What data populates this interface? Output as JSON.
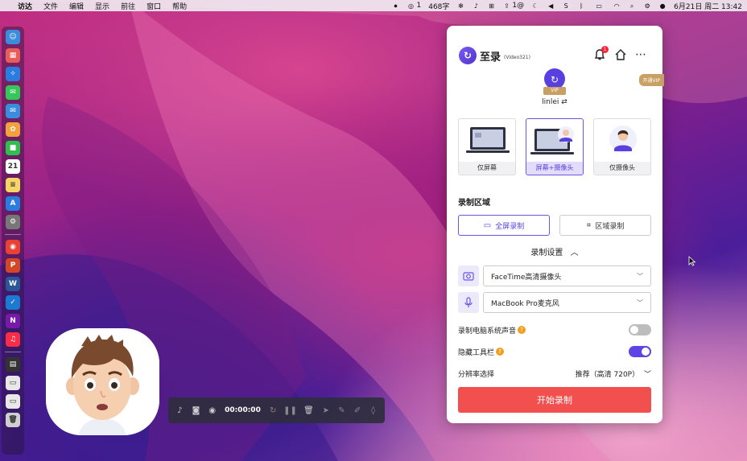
{
  "menubar": {
    "app": "访达",
    "menus": [
      "文件",
      "编辑",
      "显示",
      "前往",
      "窗口",
      "帮助"
    ],
    "status_count": "1",
    "word_count": "468字",
    "badge_count": "1@",
    "datetime": "6月21日 周二  13:42"
  },
  "dock": {
    "items": [
      {
        "icon": "finder-icon",
        "color": "#3a8dde",
        "glyph": "☺"
      },
      {
        "icon": "launchpad-icon",
        "color": "#e95c5c",
        "glyph": "▦"
      },
      {
        "icon": "safari-icon",
        "color": "#2a7de0",
        "glyph": "✧"
      },
      {
        "icon": "messages-icon",
        "color": "#34c759",
        "glyph": "✉"
      },
      {
        "icon": "mail-icon",
        "color": "#3a8dde",
        "glyph": "✉"
      },
      {
        "icon": "photos-icon",
        "color": "#f4a03c",
        "glyph": "✿"
      },
      {
        "icon": "facetime-icon",
        "color": "#2fbf4f",
        "glyph": "■"
      },
      {
        "icon": "calendar-icon",
        "color": "#ffffff",
        "glyph": "21"
      },
      {
        "icon": "notes-icon",
        "color": "#f5d563",
        "glyph": "≡"
      },
      {
        "icon": "app-store-icon",
        "color": "#2a7de0",
        "glyph": "A"
      },
      {
        "icon": "system-preferences-icon",
        "color": "#777777",
        "glyph": "⚙"
      },
      {
        "icon": "chrome-icon",
        "color": "#e94235",
        "glyph": "◉"
      },
      {
        "icon": "powerpoint-icon",
        "color": "#d24726",
        "glyph": "P"
      },
      {
        "icon": "word-icon",
        "color": "#2b579a",
        "glyph": "W"
      },
      {
        "icon": "mail-app-icon",
        "color": "#1d7ad3",
        "glyph": "✓"
      },
      {
        "icon": "onenote-icon",
        "color": "#7719aa",
        "glyph": "N"
      },
      {
        "icon": "music-icon",
        "color": "#fa2d48",
        "glyph": "♫"
      },
      {
        "icon": "activity-monitor-icon",
        "color": "#333333",
        "glyph": "▤"
      },
      {
        "icon": "document-thumbnail-icon",
        "color": "#e8e8e8",
        "glyph": "▭"
      },
      {
        "icon": "screenshot-thumbnail-icon",
        "color": "#e8e8e8",
        "glyph": "▭"
      },
      {
        "icon": "trash-icon",
        "color": "#cfcfcf",
        "glyph": "🗑"
      }
    ]
  },
  "toolbar": {
    "time": "00:00:00"
  },
  "panel": {
    "logo_text": "至录",
    "logo_sub": "(Video321)",
    "notification_count": "1",
    "vip_tag": "开通VIP",
    "avatar_vip": "VIP",
    "username": "linlei",
    "modes": [
      {
        "label": "仅屏幕",
        "active": false
      },
      {
        "label": "屏幕+摄像头",
        "active": true
      },
      {
        "label": "仅摄像头",
        "active": false
      }
    ],
    "area_title": "录制区域",
    "area_fullscreen": "全屏录制",
    "area_region": "区域录制",
    "settings_title": "录制设置",
    "camera_select": "FaceTime高清摄像头",
    "mic_select": "MacBook Pro麦克风",
    "system_audio_label": "录制电脑系统声音",
    "system_audio_on": false,
    "hide_toolbar_label": "隐藏工具栏",
    "hide_toolbar_on": true,
    "resolution_label": "分辨率选择",
    "resolution_value": "推荐（高清 720P）",
    "start_button": "开始录制",
    "accent": "#5b45e6",
    "start_color": "#f2504f"
  }
}
